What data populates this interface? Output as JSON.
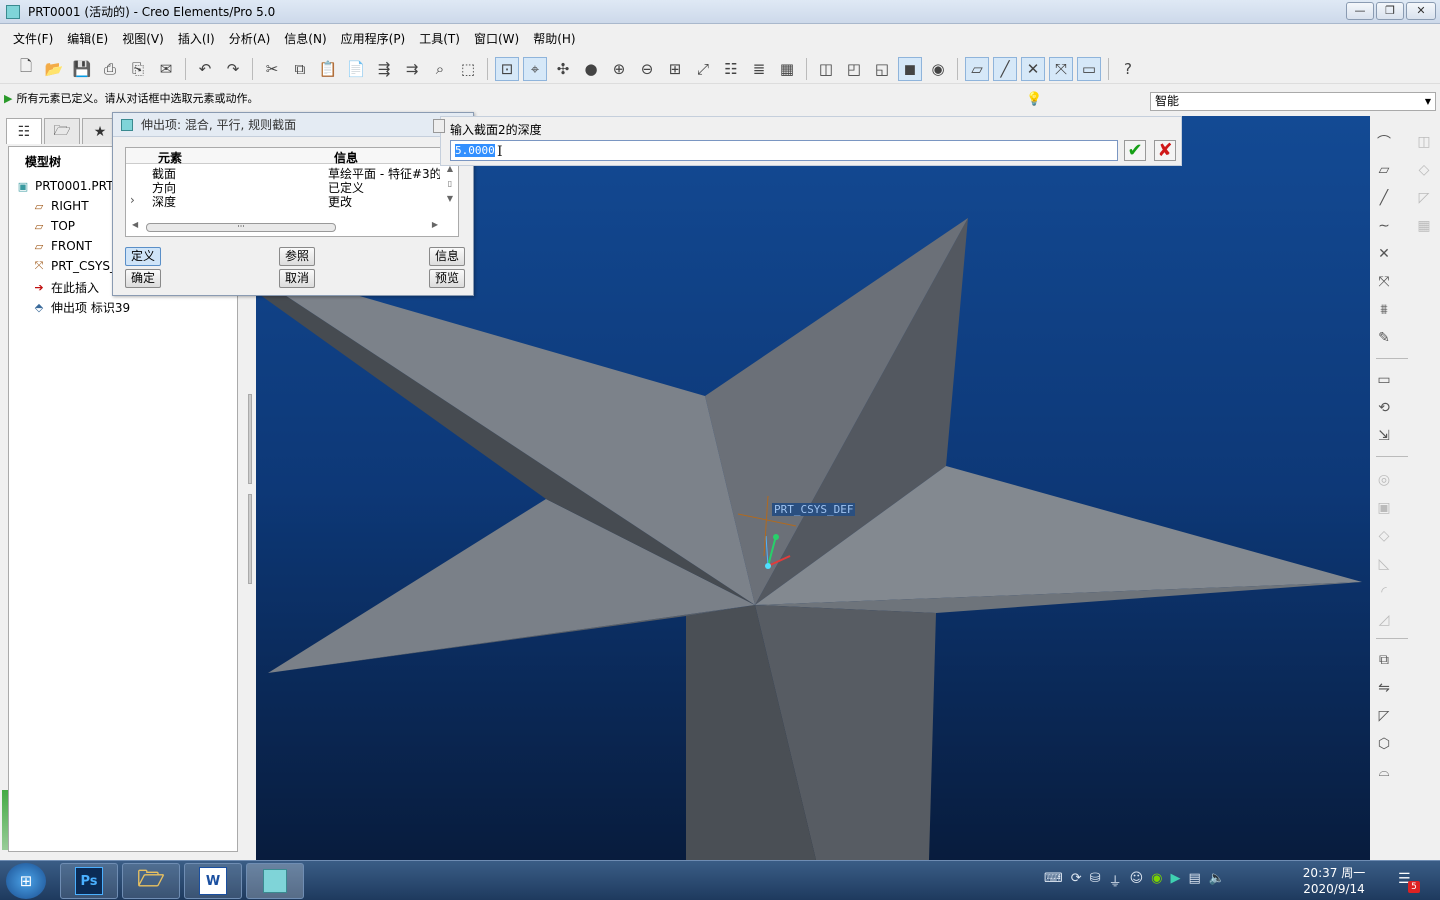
{
  "window": {
    "title": "PRT0001 (活动的) - Creo Elements/Pro 5.0"
  },
  "menu": [
    "文件(F)",
    "编辑(E)",
    "视图(V)",
    "插入(I)",
    "分析(A)",
    "信息(N)",
    "应用程序(P)",
    "工具(T)",
    "窗口(W)",
    "帮助(H)"
  ],
  "status_message": "所有元素已定义。请从对话框中选取元素或动作。",
  "filter": {
    "value": "智能"
  },
  "model_tree": {
    "title": "模型树",
    "items": [
      {
        "label": "PRT0001.PRT",
        "icon": "part-icon"
      },
      {
        "label": "RIGHT",
        "icon": "datum-plane-icon"
      },
      {
        "label": "TOP",
        "icon": "datum-plane-icon"
      },
      {
        "label": "FRONT",
        "icon": "datum-plane-icon"
      },
      {
        "label": "PRT_CSYS_",
        "icon": "csys-icon"
      },
      {
        "label": "在此插入",
        "icon": "insert-arrow-icon"
      },
      {
        "label": "伸出项 标识39",
        "icon": "protrusion-icon"
      }
    ]
  },
  "feature_dialog": {
    "title": "伸出项: 混合, 平行, 规则截面",
    "columns": [
      "元素",
      "信息"
    ],
    "rows": [
      {
        "element": "截面",
        "info": "草绘平面 - 特征#3的"
      },
      {
        "element": "方向",
        "info": "已定义"
      },
      {
        "element": "深度",
        "info": "更改"
      }
    ],
    "buttons": {
      "define": "定义",
      "refs": "参照",
      "info": "信息",
      "ok": "确定",
      "cancel": "取消",
      "preview": "预览"
    }
  },
  "depth_prompt": {
    "label": "输入截面2的深度",
    "value": "5.0000"
  },
  "viewport": {
    "csys_label": "PRT_CSYS_DEF"
  },
  "taskbar": {
    "apps": [
      "Ps",
      "文件夹",
      "W",
      "Creo"
    ],
    "clock_time": "20:37 周一",
    "clock_date": "2020/9/14",
    "notifications": "5"
  },
  "colors": {
    "viewport_top": "#134a94",
    "viewport_bottom": "#081c3d",
    "star_light": "#7b8189",
    "star_dark": "#4a4f55"
  }
}
